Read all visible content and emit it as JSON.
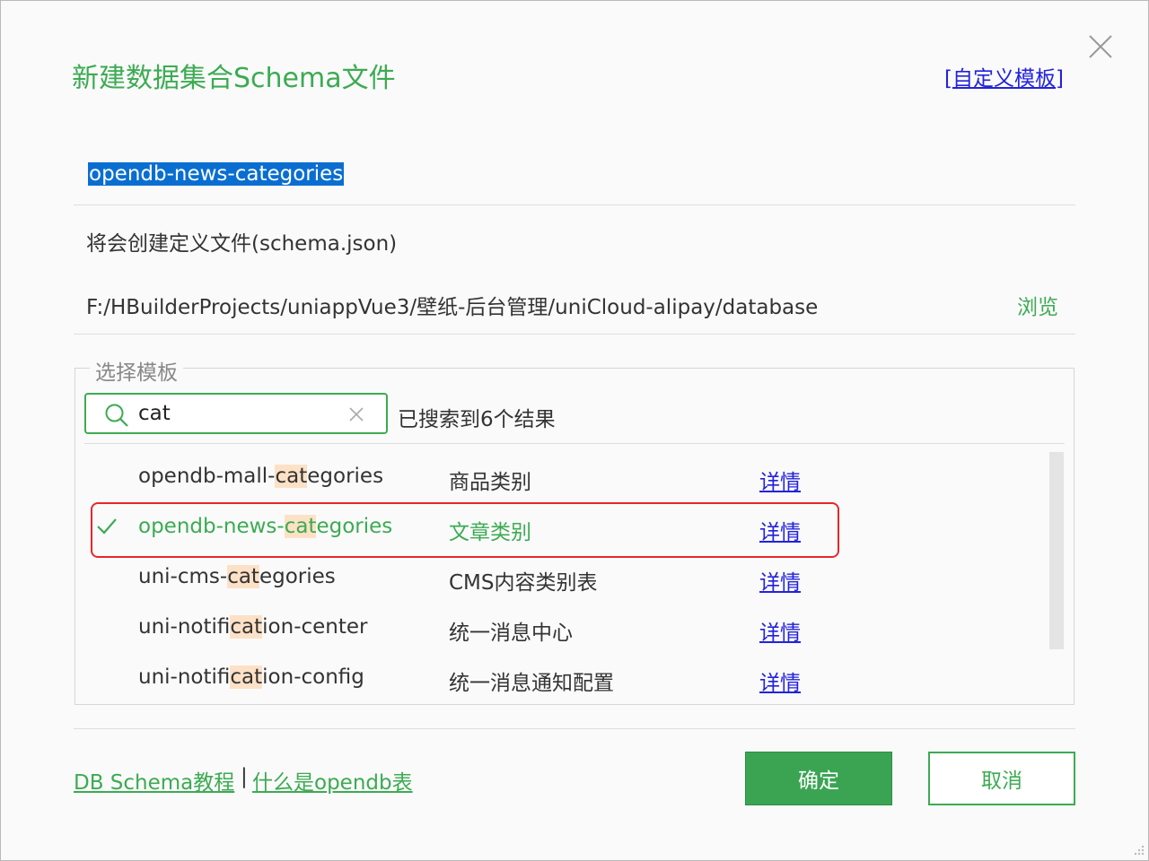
{
  "dialog": {
    "title": "新建数据集合Schema文件",
    "custom_template_link": "[自定义模板]",
    "close_icon": "close-icon"
  },
  "name_field": {
    "value": "opendb-news-categories"
  },
  "info": {
    "create_text": "将会创建定义文件(schema.json)",
    "path": "F:/HBuilderProjects/uniappVue3/壁纸-后台管理/uniCloud-alipay/database",
    "browse_label": "浏览"
  },
  "template_section": {
    "legend": "选择模板",
    "search": {
      "value": "cat",
      "placeholder": "",
      "icon": "search-icon",
      "clear_icon": "clear-icon"
    },
    "result_count": "已搜索到6个结果",
    "items": [
      {
        "name_pre": "opendb-mall-",
        "name_hl": "cat",
        "name_post": "egories",
        "desc": "商品类别",
        "detail": "详情",
        "selected": false
      },
      {
        "name_pre": "opendb-news-",
        "name_hl": "cat",
        "name_post": "egories",
        "desc": "文章类别",
        "detail": "详情",
        "selected": true
      },
      {
        "name_pre": "uni-cms-",
        "name_hl": "cat",
        "name_post": "egories",
        "desc": "CMS内容类别表",
        "detail": "详情",
        "selected": false
      },
      {
        "name_pre": "uni-notifi",
        "name_hl": "cat",
        "name_post": "ion-center",
        "desc": "统一消息中心",
        "detail": "详情",
        "selected": false
      },
      {
        "name_pre": "uni-notifi",
        "name_hl": "cat",
        "name_post": "ion-config",
        "desc": "统一消息通知配置",
        "detail": "详情",
        "selected": false
      }
    ]
  },
  "footer": {
    "link_tutorial": "DB Schema教程",
    "separator": "|",
    "link_opendb": "什么是opendb表",
    "ok_label": "确定",
    "cancel_label": "取消"
  },
  "colors": {
    "accent": "#3cab52",
    "link": "#2222dd",
    "selection_outline": "#e8262a",
    "highlight": "#fde1c6"
  }
}
